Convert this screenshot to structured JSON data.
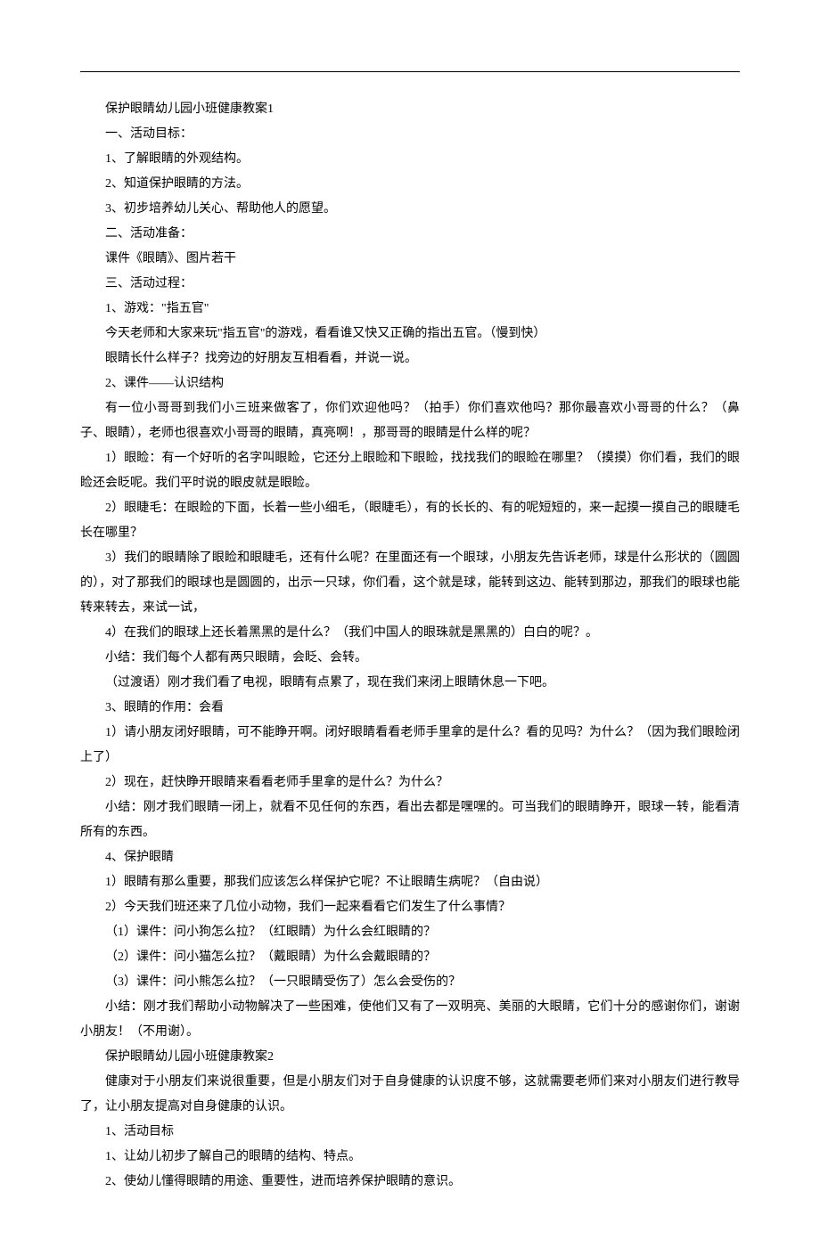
{
  "lines": [
    {
      "text": "保护眼睛幼儿园小班健康教案1",
      "indent": true
    },
    {
      "text": "一、活动目标：",
      "indent": true
    },
    {
      "text": "1、了解眼睛的外观结构。",
      "indent": true
    },
    {
      "text": "2、知道保护眼睛的方法。",
      "indent": true
    },
    {
      "text": "3、初步培养幼儿关心、帮助他人的愿望。",
      "indent": true
    },
    {
      "text": "二、活动准备：",
      "indent": true
    },
    {
      "text": "课件《眼睛》、图片若干",
      "indent": true
    },
    {
      "text": "三、活动过程：",
      "indent": true
    },
    {
      "text": "1、游戏：\"指五官\"",
      "indent": true
    },
    {
      "text": "今天老师和大家来玩\"指五官\"的游戏，看看谁又快又正确的指出五官。（慢到快）",
      "indent": true
    },
    {
      "text": "眼睛长什么样子？找旁边的好朋友互相看看，并说一说。",
      "indent": true
    },
    {
      "text": "2、课件——认识结构",
      "indent": true
    },
    {
      "text": "有一位小哥哥到我们小三班来做客了，你们欢迎他吗？（拍手）你们喜欢他吗？那你最喜欢小哥哥的什么？（鼻子、眼睛），老师也很喜欢小哥哥的眼睛，真亮啊！，那哥哥的眼睛是什么样的呢？",
      "indent": true
    },
    {
      "text": "1）眼睑：有一个好听的名字叫眼睑，它还分上眼睑和下眼睑，找找我们的眼睑在哪里？（摸摸）你们看，我们的眼睑还会眨呢。我们平时说的眼皮就是眼睑。",
      "indent": true
    },
    {
      "text": "2）眼睫毛：在眼睑的下面，长着一些小细毛，（眼睫毛），有的长长的、有的呢短短的，来一起摸一摸自己的眼睫毛长在哪里？",
      "indent": true
    },
    {
      "text": "3）我们的眼睛除了眼睑和眼睫毛，还有什么呢？在里面还有一个眼球，小朋友先告诉老师，球是什么形状的（圆圆的），对了那我们的眼球也是圆圆的，出示一只球，你们看，这个就是球，能转到这边、能转到那边，那我们的眼球也能转来转去，来试一试，",
      "indent": true
    },
    {
      "text": "4）在我们的眼球上还长着黑黑的是什么？（我们中国人的眼珠就是黑黑的）白白的呢？。",
      "indent": true
    },
    {
      "text": "小结：我们每个人都有两只眼睛，会眨、会转。",
      "indent": true
    },
    {
      "text": "（过渡语）刚才我们看了电视，眼睛有点累了，现在我们来闭上眼睛休息一下吧。",
      "indent": true
    },
    {
      "text": "3、眼睛的作用：会看",
      "indent": true
    },
    {
      "text": "1）请小朋友闭好眼睛，可不能睁开啊。闭好眼睛看看老师手里拿的是什么？看的见吗？为什么？（因为我们眼睑闭上了）",
      "indent": true
    },
    {
      "text": "2）现在，赶快睁开眼睛来看看老师手里拿的是什么？为什么？",
      "indent": true
    },
    {
      "text": "小结：刚才我们眼睛一闭上，就看不见任何的东西，看出去都是嘿嘿的。可当我们的眼睛睁开，眼球一转，能看清所有的东西。",
      "indent": true
    },
    {
      "text": "4、保护眼睛",
      "indent": true
    },
    {
      "text": "1）眼睛有那么重要，那我们应该怎么样保护它呢？不让眼睛生病呢？（自由说）",
      "indent": true
    },
    {
      "text": "2）今天我们班还来了几位小动物，我们一起来看看它们发生了什么事情？",
      "indent": true
    },
    {
      "text": "（1）课件：问小狗怎么拉？（红眼睛）为什么会红眼睛的？",
      "indent": true
    },
    {
      "text": "（2）课件：问小猫怎么拉？（戴眼睛）为什么会戴眼睛的？",
      "indent": true
    },
    {
      "text": "（3）课件：问小熊怎么拉？（一只眼睛受伤了）怎么会受伤的？",
      "indent": true
    },
    {
      "text": "小结：刚才我们帮助小动物解决了一些困难，使他们又有了一双明亮、美丽的大眼睛，它们十分的感谢你们，谢谢小朋友！（不用谢）。",
      "indent": true
    },
    {
      "text": "保护眼睛幼儿园小班健康教案2",
      "indent": true
    },
    {
      "text": "健康对于小朋友们来说很重要，但是小朋友们对于自身健康的认识度不够，这就需要老师们来对小朋友们进行教导了，让小朋友提高对自身健康的认识。",
      "indent": true
    },
    {
      "text": "1、活动目标",
      "indent": true
    },
    {
      "text": "1、让幼儿初步了解自己的眼睛的结构、特点。",
      "indent": true
    },
    {
      "text": "2、使幼儿懂得眼睛的用途、重要性，进而培养保护眼睛的意识。",
      "indent": true
    }
  ]
}
